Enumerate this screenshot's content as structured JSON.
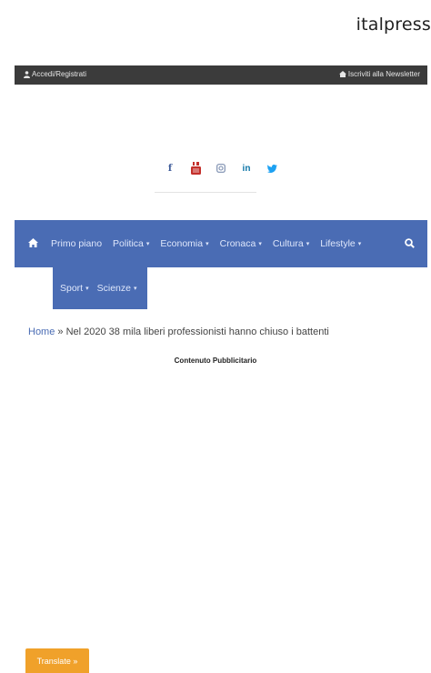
{
  "brand": "italpress",
  "topbar": {
    "login_label": "Accedi/Registrati",
    "newsletter_label": "Iscriviti alla Newsletter"
  },
  "social": {
    "icons": [
      "facebook-icon",
      "youtube-icon",
      "instagram-icon",
      "linkedin-icon",
      "twitter-icon"
    ]
  },
  "nav": {
    "items": [
      {
        "label": "Primo piano",
        "dropdown": false
      },
      {
        "label": "Politica",
        "dropdown": true
      },
      {
        "label": "Economia",
        "dropdown": true
      },
      {
        "label": "Cronaca",
        "dropdown": true
      },
      {
        "label": "Cultura",
        "dropdown": true
      },
      {
        "label": "Lifestyle",
        "dropdown": true
      }
    ],
    "sub_items": [
      {
        "label": "Sport",
        "dropdown": true
      },
      {
        "label": "Scienze",
        "dropdown": true
      }
    ],
    "caret": "▾",
    "accent": "#4a6cb4"
  },
  "breadcrumb": {
    "home": "Home",
    "separator": "»",
    "current": "Nel 2020 38 mila liberi professionisti hanno chiuso i battenti"
  },
  "ad_label": "Contenuto Pubblicitario",
  "translate_label": "Translate »",
  "colors": {
    "topbar": "#3b3b3b",
    "navbar": "#4a6cb4",
    "translate": "#f0a12a"
  }
}
